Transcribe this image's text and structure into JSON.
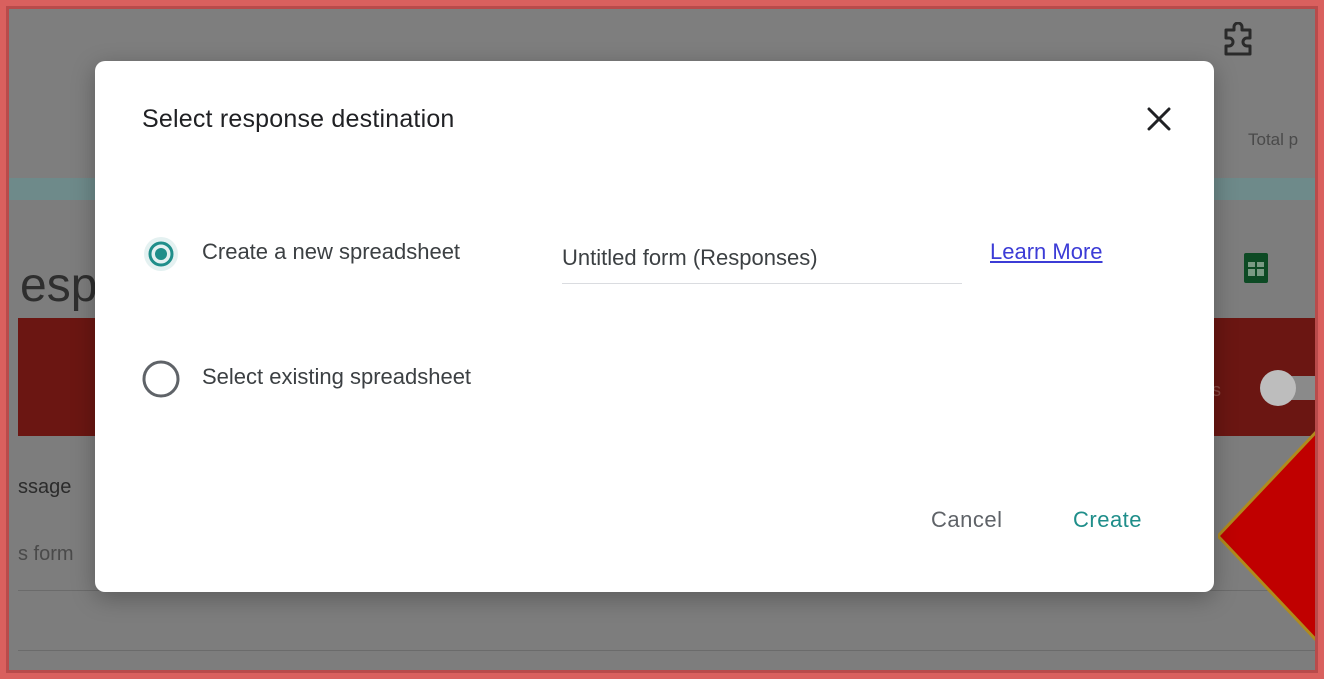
{
  "background": {
    "header_right_text": "Total p",
    "page_heading_fragment": "esp",
    "messages_fragment": "ssage",
    "form_fragment": "s form",
    "red_band_fragment": "s"
  },
  "dialog": {
    "title": "Select response destination",
    "close_icon": "close-icon",
    "options": [
      {
        "label": "Create a new spreadsheet",
        "selected": true,
        "spreadsheet_name": "Untitled form (Responses)",
        "link_label": "Learn More"
      },
      {
        "label": "Select existing spreadsheet",
        "selected": false
      }
    ],
    "buttons": {
      "cancel": "Cancel",
      "create": "Create"
    }
  },
  "colors": {
    "accent": "#1f8e8a",
    "link": "#3c3cd6",
    "frame": "#d9605e",
    "annotation_arrow": "#c00000"
  }
}
